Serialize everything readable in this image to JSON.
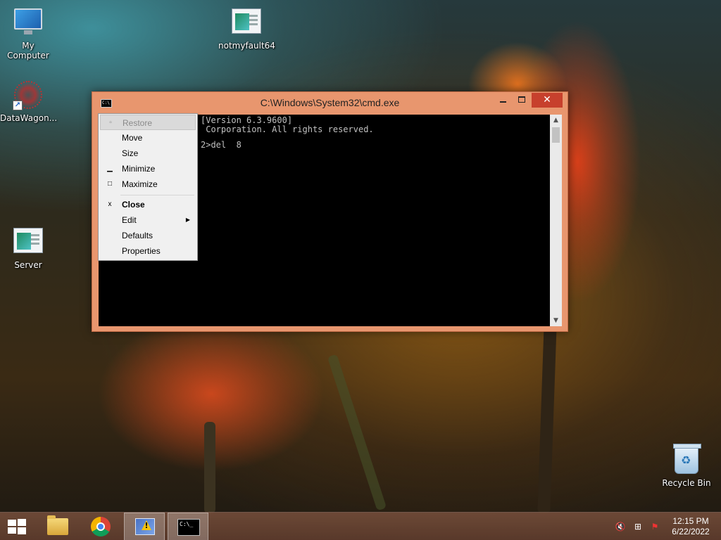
{
  "desktop": {
    "icons": [
      {
        "label": "My Computer",
        "icon": "computer-icon"
      },
      {
        "label": "notmyfault64",
        "icon": "app-window-icon"
      },
      {
        "label": "DataWagon...",
        "icon": "datawagon-icon"
      },
      {
        "label": "Server",
        "icon": "app-window-icon"
      },
      {
        "label": "Recycle Bin",
        "icon": "recycle-bin-icon"
      }
    ]
  },
  "window": {
    "title": "C:\\Windows\\System32\\cmd.exe",
    "icon_text": "C:\\",
    "close_glyph": "✕"
  },
  "console": {
    "lines": [
      "[Version 6.3.9600]",
      " Corporation. All rights reserved.",
      "",
      "2>del  8"
    ]
  },
  "system_menu": {
    "items": [
      {
        "label": "Restore",
        "glyph": "▫",
        "state": "disabled"
      },
      {
        "label": "Move",
        "glyph": ""
      },
      {
        "label": "Size",
        "glyph": ""
      },
      {
        "label": "Minimize",
        "glyph": "▁"
      },
      {
        "label": "Maximize",
        "glyph": "□"
      },
      {
        "label": "Close",
        "glyph": "x",
        "bold": true
      },
      {
        "label": "Edit",
        "glyph": "",
        "submenu": "▶"
      },
      {
        "label": "Defaults",
        "glyph": ""
      },
      {
        "label": "Properties",
        "glyph": ""
      }
    ]
  },
  "taskbar": {
    "items": [
      "start-button",
      "file-explorer",
      "chrome",
      "tool-app",
      "command-prompt"
    ],
    "cmd_icon_text": "C:\\_",
    "tray": {
      "volume_glyph": "🔇",
      "network_glyph": "⊞",
      "flag_glyph": "⚑"
    },
    "clock": {
      "time": "12:15 PM",
      "date": "6/22/2022"
    }
  },
  "colors": {
    "window_frame": "#e8966e",
    "close_button": "#c7402d",
    "console_bg": "#000000",
    "console_fg": "#c0c0c0"
  }
}
